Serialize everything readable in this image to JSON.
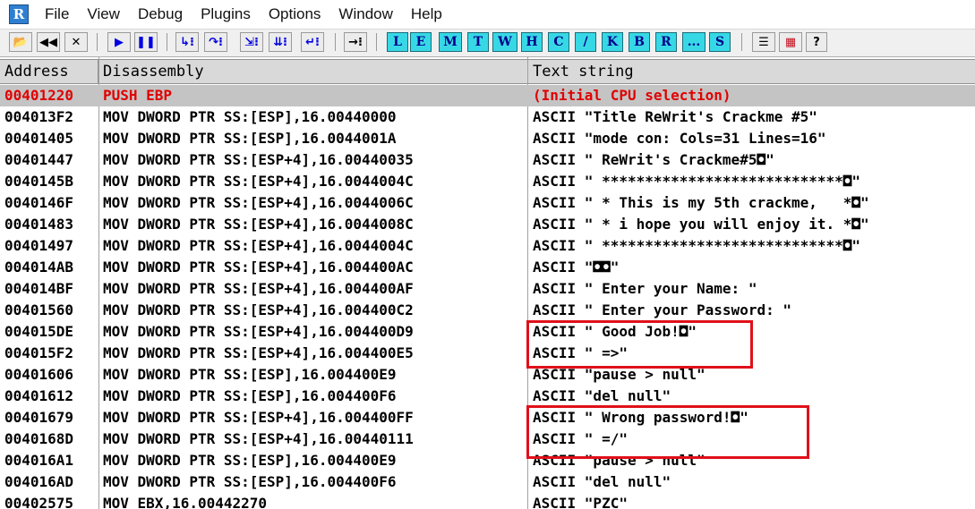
{
  "menubar": {
    "logo": "R",
    "items": [
      "File",
      "View",
      "Debug",
      "Plugins",
      "Options",
      "Window",
      "Help"
    ]
  },
  "toolbar": {
    "left_icons": [
      {
        "name": "open-icon",
        "glyph": "📂"
      },
      {
        "name": "restart-icon",
        "glyph": "◀◀"
      },
      {
        "name": "close-program-icon",
        "glyph": "✕"
      }
    ],
    "run_icons": [
      {
        "name": "run-icon",
        "glyph": "▶"
      },
      {
        "name": "pause-icon",
        "glyph": "❚❚"
      }
    ],
    "step_icons": [
      {
        "name": "step-into-icon",
        "glyph": "↳⁝"
      },
      {
        "name": "step-over-icon",
        "glyph": "↷⁝"
      },
      {
        "name": "trace-into-icon",
        "glyph": "⇲⁝"
      },
      {
        "name": "trace-over-icon",
        "glyph": "⇊⁝"
      },
      {
        "name": "execute-till-return-icon",
        "glyph": "↵⁝"
      }
    ],
    "goto_icon": {
      "name": "go-to-icon",
      "glyph": "→⁝"
    },
    "letter_buttons": [
      "L",
      "E",
      "M",
      "T",
      "W",
      "H",
      "C",
      "/",
      "K",
      "B",
      "R",
      "...",
      "S"
    ],
    "right_icons": [
      {
        "name": "list-icon",
        "glyph": "☰"
      },
      {
        "name": "palette-icon",
        "glyph": "▦"
      },
      {
        "name": "help-icon",
        "glyph": "?"
      }
    ],
    "colors": {
      "letter_bg": "#37d8e6",
      "blue_icon": "#0000e0"
    }
  },
  "table": {
    "columns": [
      "Address",
      "Disassembly",
      "Text string"
    ],
    "selected_color": "#e00000",
    "rows": [
      {
        "addr": "00401220",
        "dis": "PUSH EBP",
        "text": "(Initial CPU selection)",
        "selected": true
      },
      {
        "addr": "004013F2",
        "dis": "MOV DWORD PTR SS:[ESP],16.00440000",
        "text": "ASCII \"Title ReWrit's Crackme #5\""
      },
      {
        "addr": "00401405",
        "dis": "MOV DWORD PTR SS:[ESP],16.0044001A",
        "text": "ASCII \"mode con: Cols=31 Lines=16\""
      },
      {
        "addr": "00401447",
        "dis": "MOV DWORD PTR SS:[ESP+4],16.00440035",
        "text": "ASCII \" ReWrit's Crackme#5◘\""
      },
      {
        "addr": "0040145B",
        "dis": "MOV DWORD PTR SS:[ESP+4],16.0044004C",
        "text": "ASCII \" ****************************◘\""
      },
      {
        "addr": "0040146F",
        "dis": "MOV DWORD PTR SS:[ESP+4],16.0044006C",
        "text": "ASCII \" * This is my 5th crackme,   *◘\""
      },
      {
        "addr": "00401483",
        "dis": "MOV DWORD PTR SS:[ESP+4],16.0044008C",
        "text": "ASCII \" * i hope you will enjoy it. *◘\""
      },
      {
        "addr": "00401497",
        "dis": "MOV DWORD PTR SS:[ESP+4],16.0044004C",
        "text": "ASCII \" ****************************◘\""
      },
      {
        "addr": "004014AB",
        "dis": "MOV DWORD PTR SS:[ESP+4],16.004400AC",
        "text": "ASCII \"◘◘\""
      },
      {
        "addr": "004014BF",
        "dis": "MOV DWORD PTR SS:[ESP+4],16.004400AF",
        "text": "ASCII \" Enter your Name: \""
      },
      {
        "addr": "00401560",
        "dis": "MOV DWORD PTR SS:[ESP+4],16.004400C2",
        "text": "ASCII \" Enter your Password: \""
      },
      {
        "addr": "004015DE",
        "dis": "MOV DWORD PTR SS:[ESP+4],16.004400D9",
        "text": "ASCII \" Good Job!◘\""
      },
      {
        "addr": "004015F2",
        "dis": "MOV DWORD PTR SS:[ESP+4],16.004400E5",
        "text": "ASCII \" =>\""
      },
      {
        "addr": "00401606",
        "dis": "MOV DWORD PTR SS:[ESP],16.004400E9",
        "text": "ASCII \"pause > null\""
      },
      {
        "addr": "00401612",
        "dis": "MOV DWORD PTR SS:[ESP],16.004400F6",
        "text": "ASCII \"del null\""
      },
      {
        "addr": "00401679",
        "dis": "MOV DWORD PTR SS:[ESP+4],16.004400FF",
        "text": "ASCII \" Wrong password!◘\""
      },
      {
        "addr": "0040168D",
        "dis": "MOV DWORD PTR SS:[ESP+4],16.00440111",
        "text": "ASCII \" =/\""
      },
      {
        "addr": "004016A1",
        "dis": "MOV DWORD PTR SS:[ESP],16.004400E9",
        "text": "ASCII \"pause > null\""
      },
      {
        "addr": "004016AD",
        "dis": "MOV DWORD PTR SS:[ESP],16.004400F6",
        "text": "ASCII \"del null\""
      },
      {
        "addr": "00402575",
        "dis": "MOV EBX,16.00442270",
        "text": "ASCII \"PZC\""
      }
    ]
  },
  "highlight_color": "#e0101a"
}
